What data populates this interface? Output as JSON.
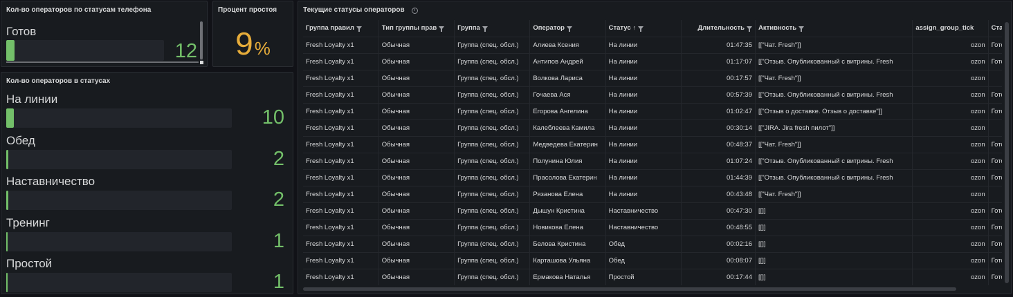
{
  "phone_panel": {
    "title": "Кол-во операторов по статусам телефона",
    "items": [
      {
        "label": "Готов",
        "value": "12",
        "fill": 0.05
      }
    ]
  },
  "idle_panel": {
    "title": "Процент простоя",
    "value": "9",
    "unit": "%"
  },
  "status_panel": {
    "title": "Кол-во операторов в статусах",
    "items": [
      {
        "label": "На линии",
        "value": "10",
        "fill": 0.04
      },
      {
        "label": "Обед",
        "value": "2",
        "fill": 0.01
      },
      {
        "label": "Наставничество",
        "value": "2",
        "fill": 0.01
      },
      {
        "label": "Тренинг",
        "value": "1",
        "fill": 0.005
      },
      {
        "label": "Простой",
        "value": "1",
        "fill": 0.005
      }
    ]
  },
  "table_panel": {
    "title": "Текущие статусы операторов",
    "columns": [
      {
        "label": "Группа правил",
        "filter": true
      },
      {
        "label": "Тип группы прав",
        "filter": true
      },
      {
        "label": "Группа",
        "filter": true
      },
      {
        "label": "Оператор",
        "filter": true
      },
      {
        "label": "Статус",
        "filter": true,
        "sort": "↑"
      },
      {
        "label": "Длительность",
        "filter": true
      },
      {
        "label": "Активность",
        "filter": true
      },
      {
        "label": "assign_group_tick",
        "filter": false
      },
      {
        "label": "Статус телефона",
        "filter": true
      }
    ],
    "rows": [
      [
        "Fresh Loyalty x1",
        "Обычная",
        "Группа (спец. обсл.)",
        "Алиева Ксения",
        "На линии",
        "01:47:35",
        "[[\"Чат. Fresh\"]]",
        "ozon",
        "Готов"
      ],
      [
        "Fresh Loyalty x1",
        "Обычная",
        "Группа (спец. обсл.)",
        "Антипов Андрей",
        "На линии",
        "01:17:07",
        "[[\"Отзыв. Опубликованный с витрины. Fresh",
        "ozon",
        "Готов"
      ],
      [
        "Fresh Loyalty x1",
        "Обычная",
        "Группа (спец. обсл.)",
        "Волкова Лариса",
        "На линии",
        "00:17:57",
        "[[\"Чат. Fresh\"]]",
        "ozon",
        ""
      ],
      [
        "Fresh Loyalty x1",
        "Обычная",
        "Группа (спец. обсл.)",
        "Гочаева Ася",
        "На линии",
        "00:57:39",
        "[[\"Отзыв. Опубликованный с витрины. Fresh",
        "ozon",
        "Готов"
      ],
      [
        "Fresh Loyalty x1",
        "Обычная",
        "Группа (спец. обсл.)",
        "Егорова Ангелина",
        "На линии",
        "01:02:47",
        "[[\"Отзыв о доставке. Отзыв о доставке\"]]",
        "ozon",
        "Готов"
      ],
      [
        "Fresh Loyalty x1",
        "Обычная",
        "Группа (спец. обсл.)",
        "Калеблеева Камила",
        "На линии",
        "00:30:14",
        "[[\"JIRA. Jira fresh пилот\"]]",
        "ozon",
        ""
      ],
      [
        "Fresh Loyalty x1",
        "Обычная",
        "Группа (спец. обсл.)",
        "Медведева Екатерин",
        "На линии",
        "00:48:37",
        "[[\"Чат. Fresh\"]]",
        "ozon",
        "Готов"
      ],
      [
        "Fresh Loyalty x1",
        "Обычная",
        "Группа (спец. обсл.)",
        "Полунина Юлия",
        "На линии",
        "01:07:24",
        "[[\"Отзыв. Опубликованный с витрины. Fresh",
        "ozon",
        "Готов"
      ],
      [
        "Fresh Loyalty x1",
        "Обычная",
        "Группа (спец. обсл.)",
        "Прасолова Екатерин",
        "На линии",
        "01:44:39",
        "[[\"Отзыв. Опубликованный с витрины. Fresh",
        "ozon",
        "Готов"
      ],
      [
        "Fresh Loyalty x1",
        "Обычная",
        "Группа (спец. обсл.)",
        "Рязанова Елена",
        "На линии",
        "00:43:48",
        "[[\"Чат. Fresh\"]]",
        "ozon",
        ""
      ],
      [
        "Fresh Loyalty x1",
        "Обычная",
        "Группа (спец. обсл.)",
        "Дышун Кристина",
        "Наставничество",
        "00:47:30",
        "[[]]",
        "ozon",
        "Готов"
      ],
      [
        "Fresh Loyalty x1",
        "Обычная",
        "Группа (спец. обсл.)",
        "Новикова Елена",
        "Наставничество",
        "00:48:55",
        "[[]]",
        "ozon",
        "Готов"
      ],
      [
        "Fresh Loyalty x1",
        "Обычная",
        "Группа (спец. обсл.)",
        "Белова Кристина",
        "Обед",
        "00:02:16",
        "[[]]",
        "ozon",
        "Готов"
      ],
      [
        "Fresh Loyalty x1",
        "Обычная",
        "Группа (спец. обсл.)",
        "Карташова Ульяна",
        "Обед",
        "00:08:07",
        "[[]]",
        "ozon",
        "Готов"
      ],
      [
        "Fresh Loyalty x1",
        "Обычная",
        "Группа (спец. обсл.)",
        "Ермакова Наталья",
        "Простой",
        "00:17:44",
        "[[]]",
        "ozon",
        "Готов"
      ]
    ]
  },
  "colors": {
    "gauge_green": "#73bf69",
    "idle_orange": "#e6ac3a",
    "panel_bg": "#181b1f",
    "page_bg": "#111217"
  }
}
